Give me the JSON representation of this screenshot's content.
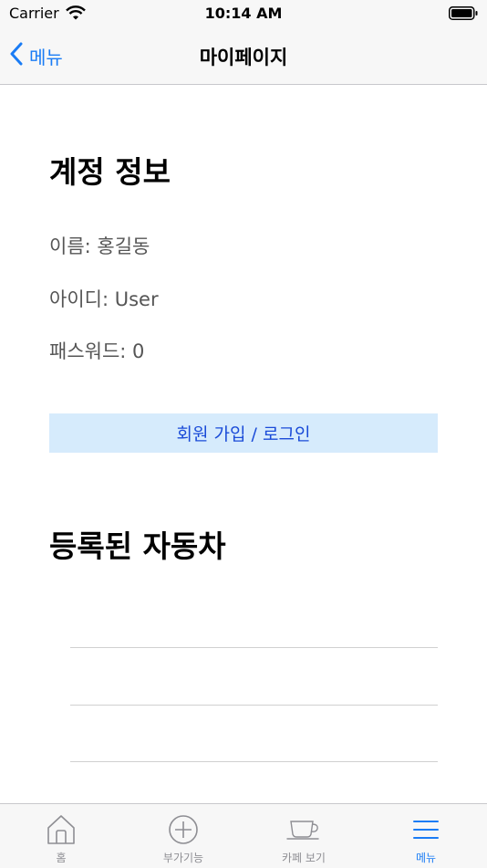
{
  "status_bar": {
    "carrier": "Carrier",
    "time": "10:14 AM"
  },
  "nav": {
    "back_label": "메뉴",
    "title": "마이페이지"
  },
  "account": {
    "title": "계정 정보",
    "name_label": "이름: ",
    "name_value": "홍길동",
    "id_label": "아이디: ",
    "id_value": "User",
    "password_label": "패스워드: ",
    "password_value": "0"
  },
  "signup_button": "회원 가입 / 로그인",
  "cars": {
    "title": "등록된 자동차"
  },
  "tabs": [
    {
      "label": "홈",
      "icon": "home-icon"
    },
    {
      "label": "부가기능",
      "icon": "plus-circle-icon"
    },
    {
      "label": "카페 보기",
      "icon": "cup-icon"
    },
    {
      "label": "메뉴",
      "icon": "menu-icon"
    }
  ],
  "colors": {
    "accent": "#1a7cf5",
    "button_bg": "#d6ebfc",
    "button_text": "#1a4bd8"
  }
}
